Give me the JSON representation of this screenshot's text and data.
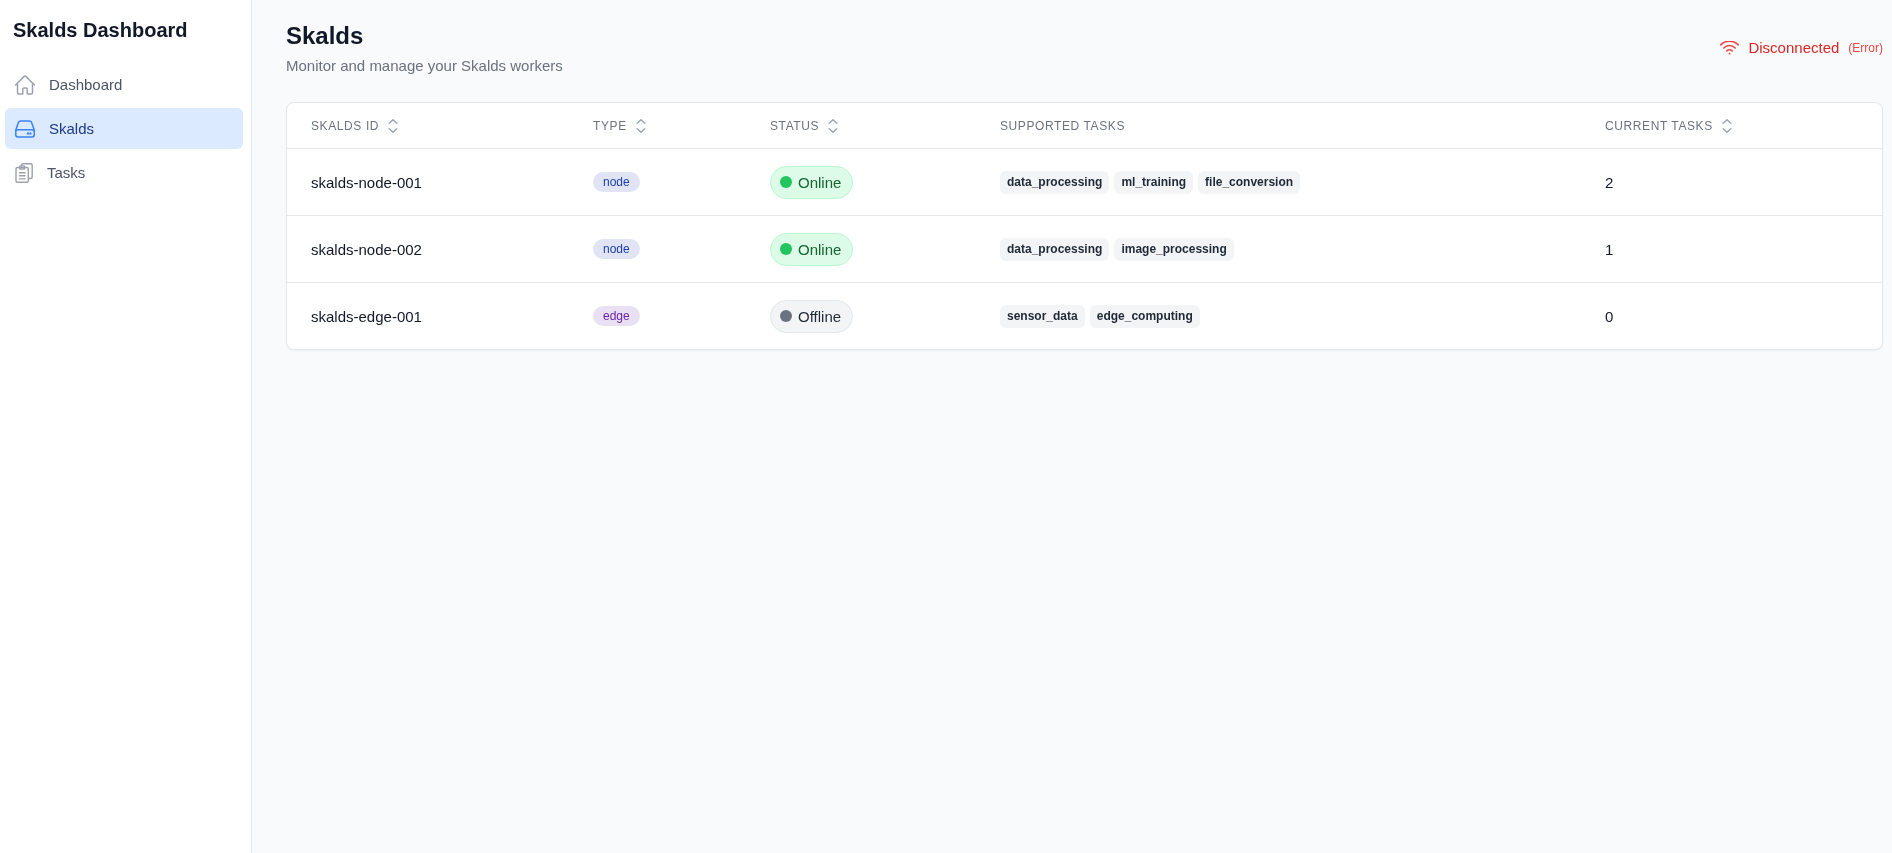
{
  "sidebar": {
    "title": "Skalds Dashboard",
    "items": [
      {
        "label": "Dashboard",
        "selected": false
      },
      {
        "label": "Skalds",
        "selected": true
      },
      {
        "label": "Tasks",
        "selected": false
      }
    ]
  },
  "header": {
    "title": "Skalds",
    "subtitle": "Monitor and manage your Skalds workers",
    "connection": {
      "connected": false,
      "label": "Disconnected",
      "detail": "(Error)"
    }
  },
  "table": {
    "columns": [
      {
        "label": "SKALDS ID",
        "sortable": true
      },
      {
        "label": "TYPE",
        "sortable": true
      },
      {
        "label": "STATUS",
        "sortable": true
      },
      {
        "label": "SUPPORTED TASKS",
        "sortable": false
      },
      {
        "label": "CURRENT TASKS",
        "sortable": true
      }
    ],
    "rows": [
      {
        "id": "skalds-node-001",
        "type": {
          "label": "node",
          "color": "#1e40af"
        },
        "status": {
          "label": "Online",
          "online": true
        },
        "supported_tasks": [
          "data_processing",
          "ml_training",
          "file_conversion"
        ],
        "current_tasks": "2"
      },
      {
        "id": "skalds-node-002",
        "type": {
          "label": "node",
          "color": "#1e40af"
        },
        "status": {
          "label": "Online",
          "online": true
        },
        "supported_tasks": [
          "data_processing",
          "image_processing"
        ],
        "current_tasks": "1"
      },
      {
        "id": "skalds-edge-001",
        "type": {
          "label": "edge",
          "color": "#6b21a8"
        },
        "status": {
          "label": "Offline",
          "online": false
        },
        "supported_tasks": [
          "sensor_data",
          "edge_computing"
        ],
        "current_tasks": "0"
      }
    ]
  }
}
